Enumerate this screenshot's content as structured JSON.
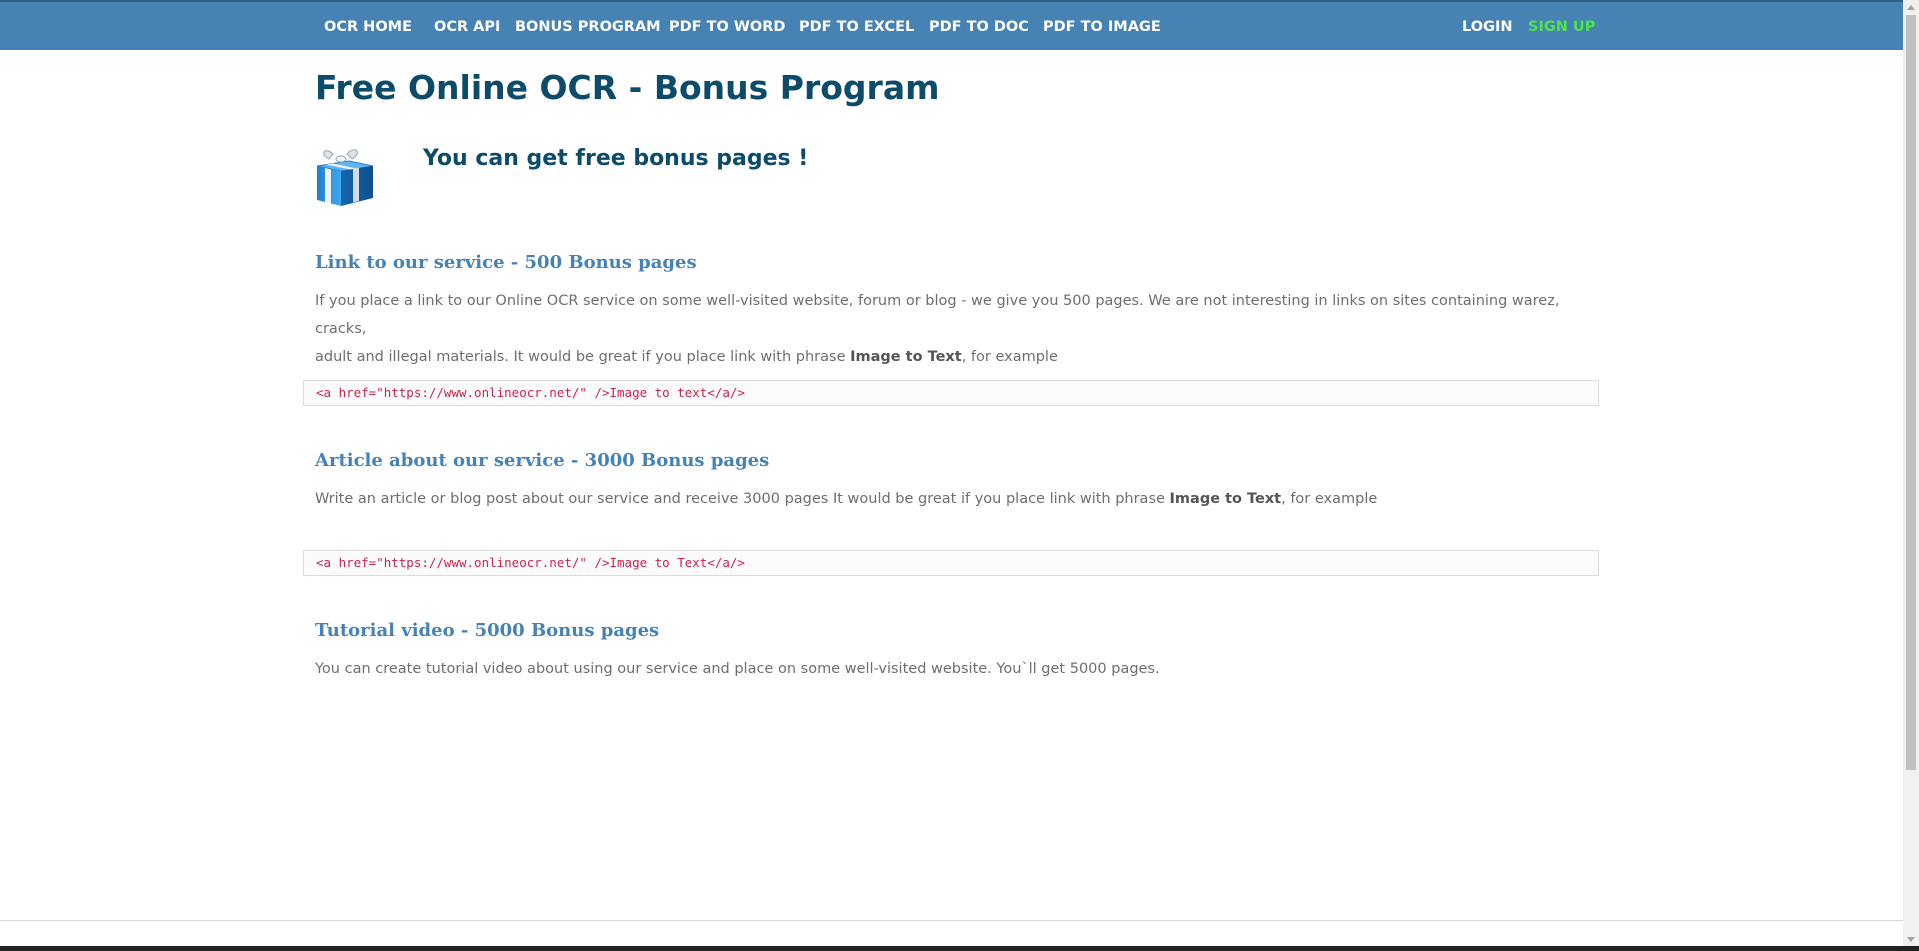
{
  "nav": {
    "left_items": [
      "OCR HOME",
      "OCR API",
      "BONUS PROGRAM",
      "PDF TO WORD",
      "PDF TO EXCEL",
      "PDF TO DOC",
      "PDF TO IMAGE"
    ],
    "login": "LOGIN",
    "signup": "SIGN UP"
  },
  "page": {
    "title": "Free Online OCR - Bonus Program",
    "subtitle": "You can get free bonus pages !",
    "gift_icon": "gift-box-icon"
  },
  "sections": [
    {
      "heading": "Link to our service - 500 Bonus pages",
      "text_line1": "If you place a link to our Online OCR service on some well-visited website, forum or blog - we give you 500 pages. We are not interesting in links on sites containing warez, cracks,",
      "text_before_bold": "adult and illegal materials. It would be great if you place link with phrase ",
      "bold": "Image to Text",
      "text_after_bold": ", for example",
      "code": "<a href=\"https://www.onlineocr.net/\" />Image to text</a/>"
    },
    {
      "heading": "Article about our service - 3000 Bonus pages",
      "text_before_bold": "Write an article or blog post about our service and receive 3000 pages It would be great if you place link with phrase ",
      "bold": "Image to Text",
      "text_after_bold": ", for example",
      "code": "<a href=\"https://www.onlineocr.net/\" />Image to Text</a/>"
    },
    {
      "heading": "Tutorial video - 5000 Bonus pages",
      "text": "You can create tutorial video about using our service and place on some well-visited website. You`ll get 5000 pages."
    }
  ],
  "colors": {
    "nav_bg": "#4682b4",
    "title": "#0d4b6b",
    "heading": "#4682b4",
    "signup": "#4ee44e",
    "code": "#c7254e"
  }
}
